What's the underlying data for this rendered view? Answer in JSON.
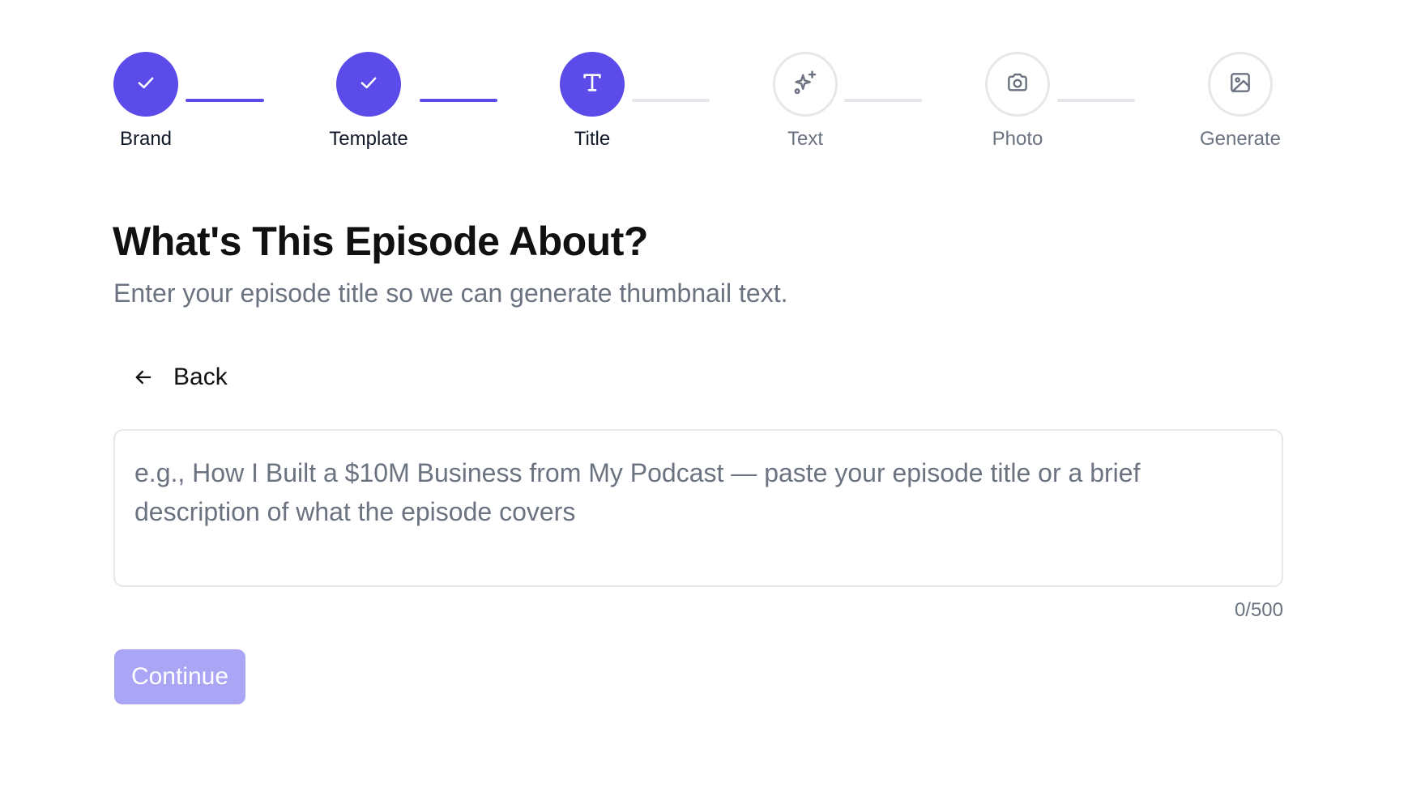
{
  "colors": {
    "accent": "#5b4be8",
    "accent_disabled": "#aaa5f5",
    "inactive_border": "#e5e7eb",
    "muted_text": "#6b7280"
  },
  "stepper": {
    "steps": [
      {
        "label": "Brand",
        "state": "completed",
        "icon": "check-icon"
      },
      {
        "label": "Template",
        "state": "completed",
        "icon": "check-icon"
      },
      {
        "label": "Title",
        "state": "current",
        "icon": "type-icon"
      },
      {
        "label": "Text",
        "state": "upcoming",
        "icon": "sparkles-icon"
      },
      {
        "label": "Photo",
        "state": "upcoming",
        "icon": "camera-icon"
      },
      {
        "label": "Generate",
        "state": "upcoming",
        "icon": "image-icon"
      }
    ]
  },
  "main": {
    "heading": "What's This Episode About?",
    "subheading": "Enter your episode title so we can generate thumbnail text.",
    "back_label": "Back",
    "back_icon": "arrow-left-icon",
    "input": {
      "value": "",
      "placeholder": "e.g., How I Built a $10M Business from My Podcast — paste your episode title or a brief description of what the episode covers",
      "char_count": "0/500"
    },
    "continue_label": "Continue",
    "continue_disabled": true
  }
}
